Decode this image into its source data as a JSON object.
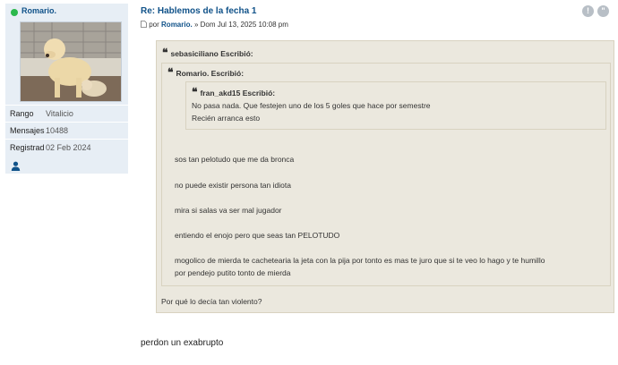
{
  "profile": {
    "username": "Romario.",
    "fields": [
      {
        "label": "Rango",
        "value": "Vitalicio"
      },
      {
        "label": "Mensajes",
        "value": "10488"
      },
      {
        "label": "Registrad",
        "value": "02 Feb 2024"
      }
    ]
  },
  "post": {
    "title": "Re: Hablemos de la fecha 1",
    "by": "por",
    "author": "Romario.",
    "date": "» Dom Jul 13, 2025 10:08 pm",
    "report_icon": "!",
    "quote_icon": "\""
  },
  "quote_outer": {
    "cite": "sebasiciliano Escribió:",
    "footer": "Por qué lo decía tan violento?"
  },
  "quote_middle": {
    "cite": "Romario. Escribió:",
    "lines": [
      "sos tan pelotudo que me da bronca",
      "no puede existir persona tan idiota",
      "mira si salas va ser mal jugador",
      "entiendo el enojo pero que seas tan PELOTUDO",
      "mogolico de mierda te cachetearia la jeta con la pija por tonto es mas te juro que si te veo lo hago y te humillo",
      "por pendejo putito tonto de mierda"
    ]
  },
  "quote_inner": {
    "cite": "fran_akd15 Escribió:",
    "lines": [
      "No pasa nada. Que festejen uno de los 5 goles que hace por semestre",
      "Recién arranca esto"
    ]
  },
  "reply": "perdon un exabrupto"
}
